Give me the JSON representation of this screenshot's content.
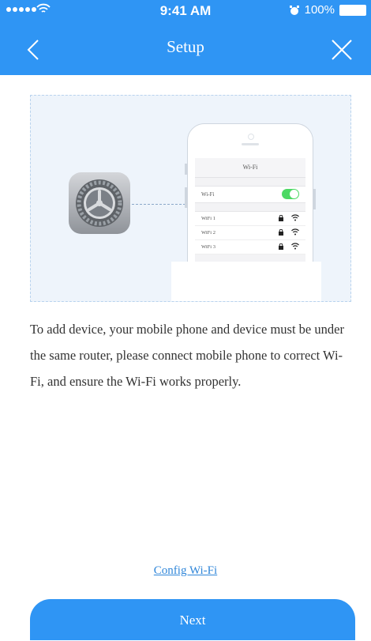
{
  "status_bar": {
    "time": "9:41 AM",
    "battery": "100%"
  },
  "nav": {
    "title": "Setup",
    "back_icon": "chevron-left-icon",
    "close_icon": "close-icon"
  },
  "illustration": {
    "phone_screen_title": "Wi-Fi",
    "wifi_toggle_label": "Wi-Fi",
    "networks": [
      "WiFi 1",
      "WiFi 2",
      "WiFi 3"
    ]
  },
  "instructions": "To add device, your mobile phone and device must be under the same router, please connect mobile phone to correct Wi-Fi, and ensure the Wi-Fi works properly.",
  "config_link": "Config Wi-Fi",
  "next_button": "Next",
  "colors": {
    "primary": "#2f95f4",
    "link": "#2f86d9",
    "toggle_on": "#4cd964"
  }
}
